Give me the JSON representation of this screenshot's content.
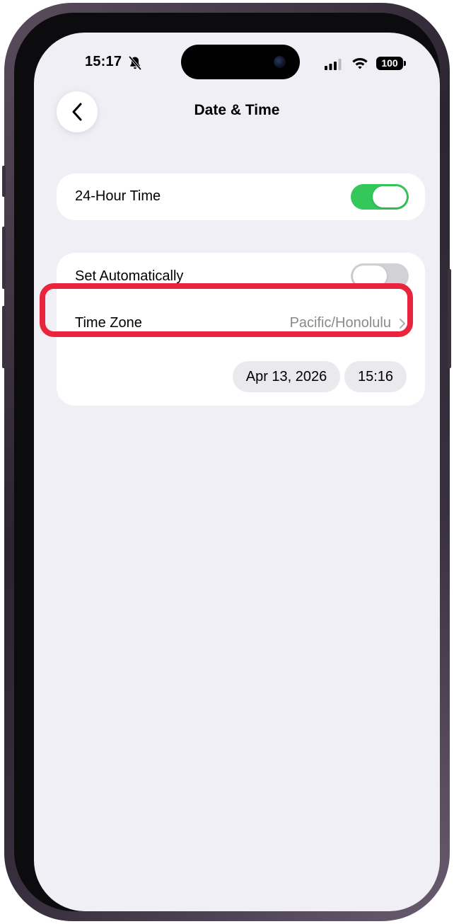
{
  "status_bar": {
    "time": "15:17",
    "battery": "100"
  },
  "header": {
    "title": "Date & Time"
  },
  "settings": {
    "hour_format": {
      "label": "24-Hour Time",
      "enabled": true
    },
    "set_automatically": {
      "label": "Set Automatically",
      "enabled": false
    },
    "time_zone": {
      "label": "Time Zone",
      "value": "Pacific/Honolulu"
    },
    "date_value": "Apr 13, 2026",
    "time_value": "15:16"
  },
  "icons": {
    "back": "chevron-left-icon",
    "silent": "bell-slash-icon",
    "signal": "cellular-signal-icon",
    "wifi": "wifi-icon",
    "battery": "battery-icon",
    "disclosure": "chevron-right-icon"
  },
  "colors": {
    "toggle_on": "#34c759",
    "toggle_off": "#d1d1d6",
    "background": "#f0eff5",
    "highlight": "#e9253d",
    "secondary_text": "#8a8a8e"
  }
}
